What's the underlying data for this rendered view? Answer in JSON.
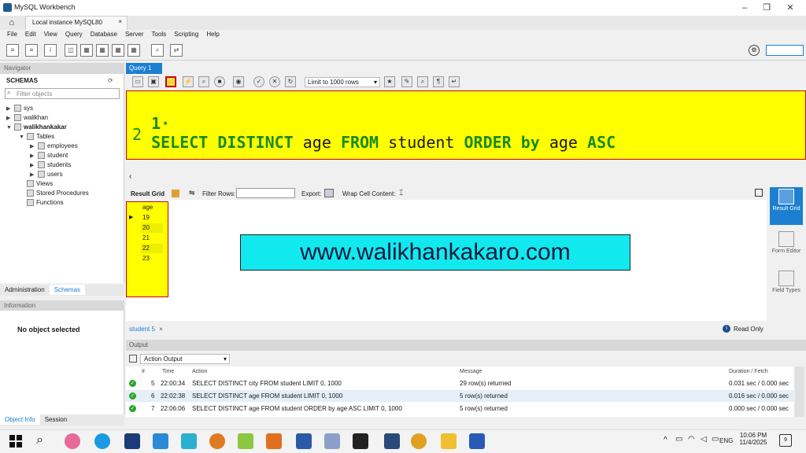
{
  "window": {
    "title": "MySQL Workbench",
    "minimize": "–",
    "restore": "❐",
    "close": "✕"
  },
  "conn_tab": {
    "label": "Local instance MySQL80",
    "close": "×"
  },
  "menu": [
    "File",
    "Edit",
    "View",
    "Query",
    "Database",
    "Server",
    "Tools",
    "Scripting",
    "Help"
  ],
  "navigator": {
    "header": "Navigator",
    "schemas_label": "SCHEMAS",
    "filter_placeholder": "Filter objects",
    "schemas": [
      "sys",
      "walikhan",
      "walikhankakar"
    ],
    "tables_label": "Tables",
    "tables": [
      "employees",
      "student",
      "students",
      "users"
    ],
    "folders": [
      "Views",
      "Stored Procedures",
      "Functions"
    ],
    "tabs": [
      "Administration",
      "Schemas"
    ]
  },
  "information": {
    "header": "Information",
    "message": "No object selected",
    "tabs": [
      "Object Info",
      "Session"
    ]
  },
  "query_tab": {
    "label": "Query 1",
    "close": "×"
  },
  "limit": {
    "label": "Limit to 1000 rows"
  },
  "editor": {
    "line1_num": "1·",
    "line1_tokens": [
      {
        "text": "SELECT DISTINCT",
        "kw": true
      },
      {
        "text": " age ",
        "kw": false
      },
      {
        "text": "FROM",
        "kw": true
      },
      {
        "text": " student ",
        "kw": false
      },
      {
        "text": "ORDER by",
        "kw": true
      },
      {
        "text": " age ",
        "kw": false
      },
      {
        "text": "ASC",
        "kw": true
      }
    ],
    "line2_num": "2"
  },
  "result_bar": {
    "result_grid": "Result Grid",
    "filter_rows": "Filter Rows:",
    "export": "Export:",
    "wrap": "Wrap Cell Content:"
  },
  "grid": {
    "column": "age",
    "rows": [
      "19",
      "20",
      "21",
      "22",
      "23"
    ]
  },
  "banner": "www.walikhankakaro.com",
  "side_panel": [
    {
      "label": "Result Grid"
    },
    {
      "label": "Form Editor"
    },
    {
      "label": "Field Types"
    }
  ],
  "result_tab": {
    "label": "student 5",
    "close": "×",
    "readonly": "Read Only"
  },
  "output": {
    "header": "Output",
    "selector": "Action Output",
    "columns": [
      "#",
      "Time",
      "Action",
      "Message",
      "Duration / Fetch"
    ],
    "rows": [
      {
        "num": "5",
        "time": "22:00:34",
        "action": "SELECT DISTINCT city FROM student LIMIT 0, 1000",
        "message": "29 row(s) returned",
        "duration": "0.031 sec / 0.000 sec"
      },
      {
        "num": "6",
        "time": "22:02:38",
        "action": "SELECT DISTINCT age FROM student LIMIT 0, 1000",
        "message": "5 row(s) returned",
        "duration": "0.016 sec / 0.000 sec"
      },
      {
        "num": "7",
        "time": "22:06:06",
        "action": "SELECT DISTINCT age FROM student ORDER by age ASC LIMIT 0, 1000",
        "message": "5 row(s) returned",
        "duration": "0.000 sec / 0.000 sec"
      }
    ]
  },
  "taskbar": {
    "lang": "ENG",
    "time": "10:06 PM",
    "date": "11/4/2025",
    "notif": "9"
  },
  "colors": {
    "editor_bg": "#ffff00",
    "keyword": "#1a8a1a",
    "banner_bg": "#12e9ef",
    "highlight_border": "#cc0000",
    "accent": "#1c7fd1"
  }
}
